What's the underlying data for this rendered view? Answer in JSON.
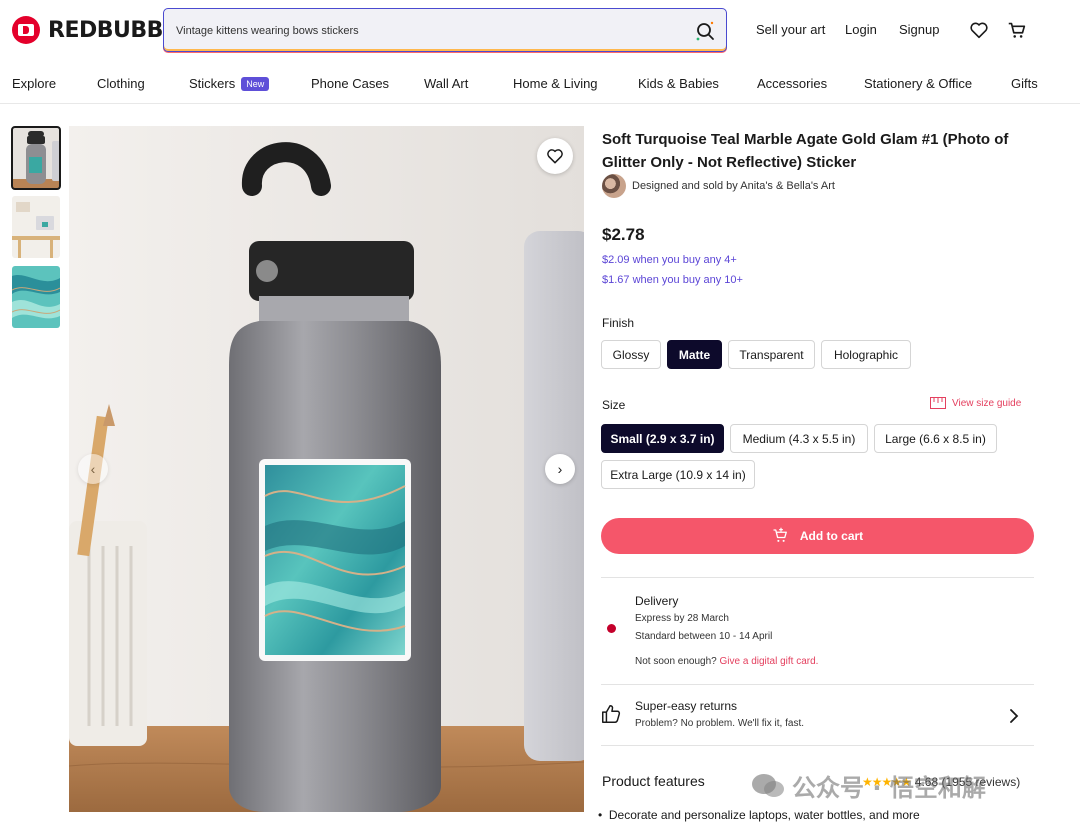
{
  "brand": {
    "name": "REDBUBBLE"
  },
  "search": {
    "value": "Vintage kittens wearing bows stickers"
  },
  "header_links": {
    "sell": "Sell your art",
    "login": "Login",
    "signup": "Signup"
  },
  "nav": {
    "items": [
      "Explore",
      "Clothing",
      "Stickers",
      "Phone Cases",
      "Wall Art",
      "Home & Living",
      "Kids & Babies",
      "Accessories",
      "Stationery & Office",
      "Gifts"
    ],
    "new_badge": "New"
  },
  "product": {
    "title": "Soft Turquoise Teal Marble Agate Gold Glam #1 (Photo of Glitter Only - Not Reflective) Sticker",
    "artist_line": "Designed and sold by Anita's & Bella's Art",
    "price": "$2.78",
    "bulk_prices": [
      "$2.09 when you buy any 4+",
      "$1.67 when you buy any 10+"
    ]
  },
  "finish": {
    "label": "Finish",
    "options": [
      "Glossy",
      "Matte",
      "Transparent",
      "Holographic"
    ],
    "selected": "Matte"
  },
  "size": {
    "label": "Size",
    "guide_label": "View size guide",
    "options": [
      "Small (2.9 x 3.7 in)",
      "Medium (4.3 x 5.5 in)",
      "Large (6.6 x 8.5 in)",
      "Extra Large (10.9 x 14 in)"
    ],
    "selected": "Small (2.9 x 3.7 in)"
  },
  "cart": {
    "label": "Add to cart"
  },
  "delivery": {
    "heading": "Delivery",
    "express": "Express by 28 March",
    "standard": "Standard between 10 - 14 April",
    "not_soon": "Not soon enough?",
    "gift_link": "Give a digital gift card."
  },
  "returns": {
    "heading": "Super-easy returns",
    "text": "Problem? No problem. We'll fix it, fast."
  },
  "features": {
    "heading": "Product features",
    "rating": "4.68 (1955 reviews)",
    "stars": "★★★★★",
    "bullets": [
      "Decorate and personalize laptops, water bottles, and more"
    ]
  },
  "watermark": {
    "text": "公众号 · 悟空和解"
  },
  "colors": {
    "accent": "#f5566a",
    "selected": "#0d0a2b",
    "bulk_text": "#5b45d6",
    "brand_red": "#e4002b"
  }
}
